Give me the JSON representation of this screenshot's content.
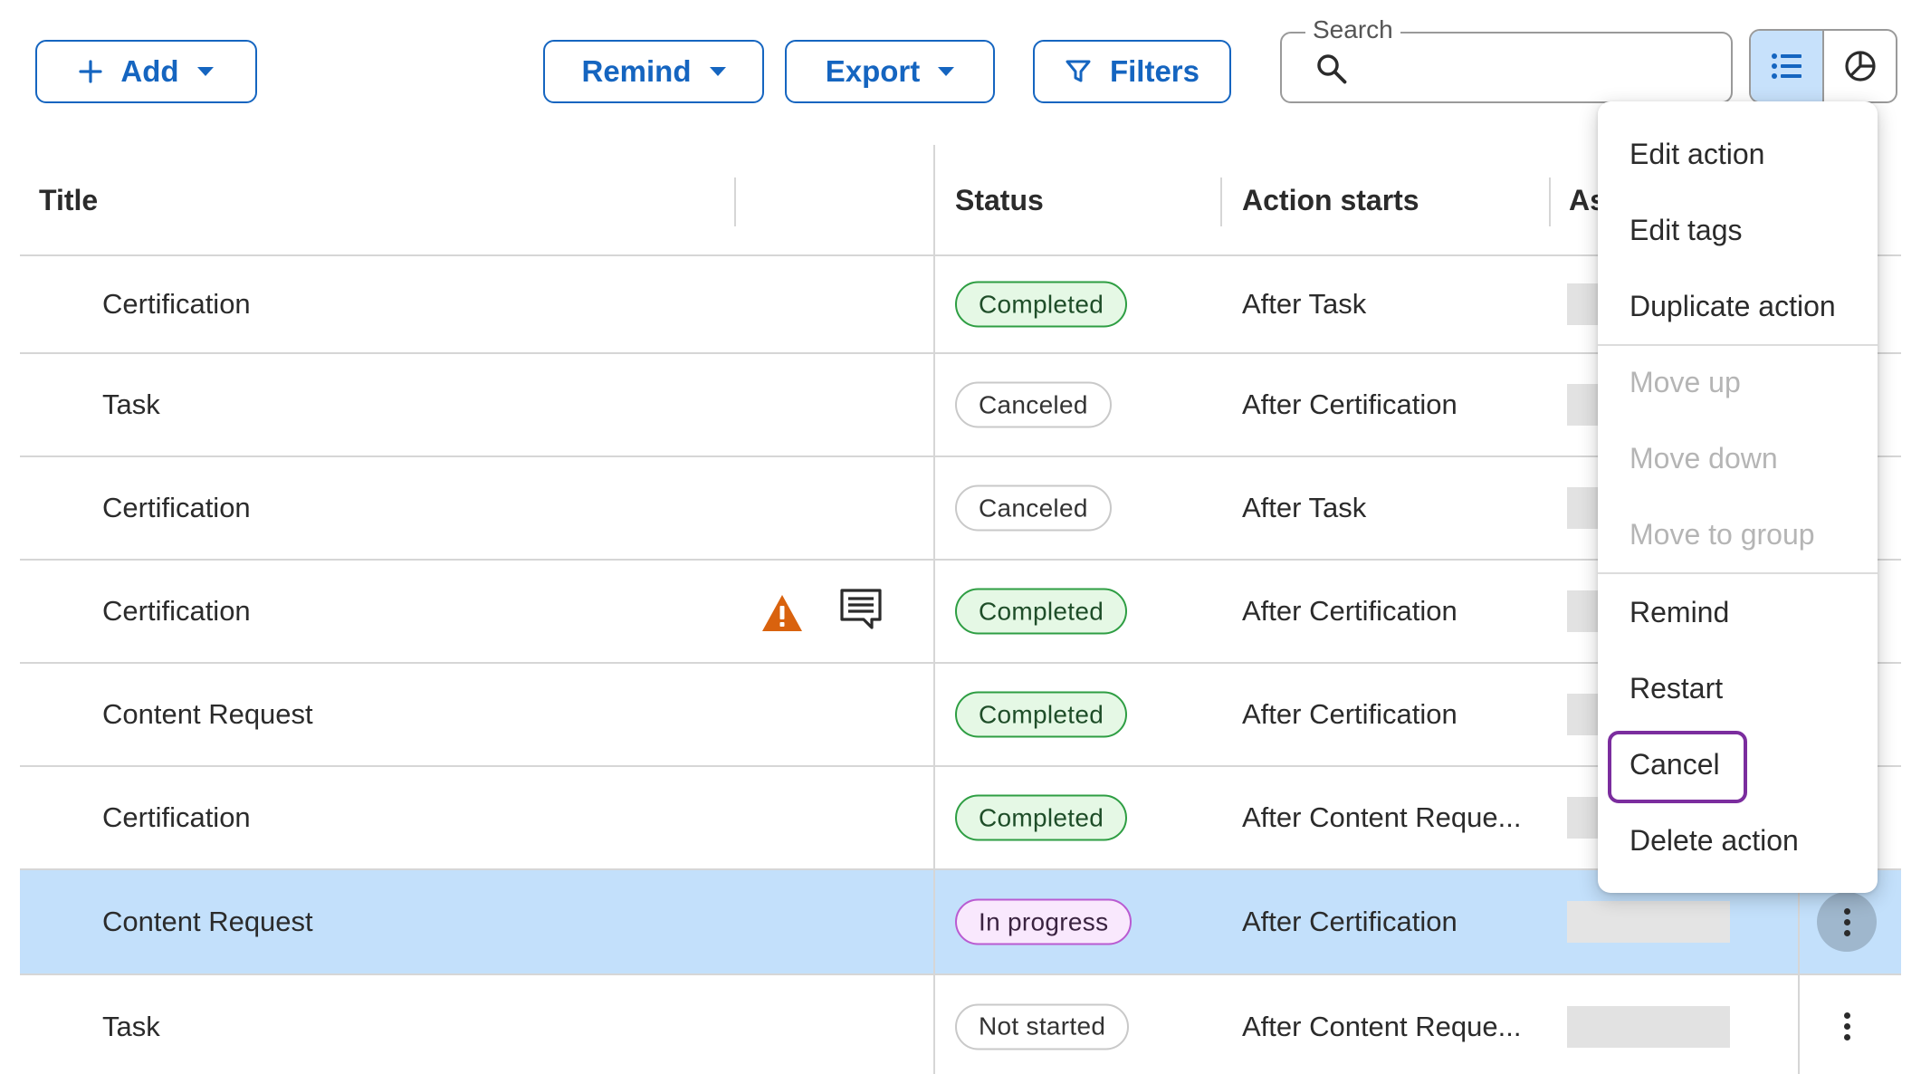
{
  "toolbar": {
    "add_label": "Add",
    "remind_label": "Remind",
    "export_label": "Export",
    "filters_label": "Filters",
    "search_label": "Search",
    "search_value": ""
  },
  "columns": {
    "title": "Title",
    "status": "Status",
    "action_starts": "Action starts",
    "assignee_partial": "As"
  },
  "rows": [
    {
      "title": "Certification",
      "status": "Completed",
      "starts": "After Task"
    },
    {
      "title": "Task",
      "status": "Canceled",
      "starts": "After Certification"
    },
    {
      "title": "Certification",
      "status": "Canceled",
      "starts": "After Task"
    },
    {
      "title": "Certification",
      "status": "Completed",
      "starts": "After Certification"
    },
    {
      "title": "Content Request",
      "status": "Completed",
      "starts": "After Certification"
    },
    {
      "title": "Certification",
      "status": "Completed",
      "starts": "After Content Reque..."
    },
    {
      "title": "Content Request",
      "status": "In progress",
      "starts": "After Certification"
    },
    {
      "title": "Task",
      "status": "Not started",
      "starts": "After Content Reque..."
    }
  ],
  "menu": {
    "edit_action": "Edit action",
    "edit_tags": "Edit tags",
    "duplicate_action": "Duplicate action",
    "move_up": "Move up",
    "move_down": "Move down",
    "move_to_group": "Move to group",
    "remind": "Remind",
    "restart": "Restart",
    "cancel": "Cancel",
    "delete_action": "Delete action"
  },
  "colors": {
    "primary": "#1565c0",
    "selected_row": "#c3e0fb",
    "completed": "#2e9e43",
    "in_progress": "#b95bd1",
    "warning": "#d9620e",
    "focus": "#7b2d9e"
  }
}
